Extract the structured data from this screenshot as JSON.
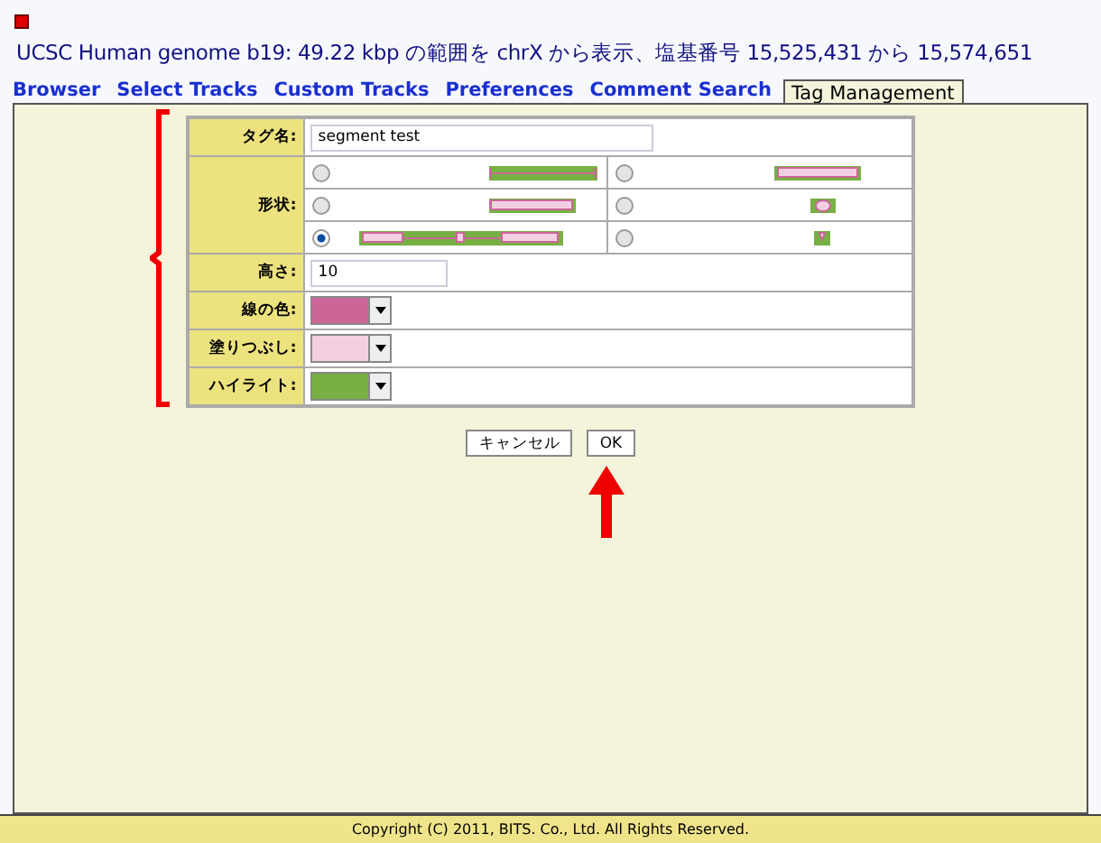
{
  "page": {
    "title": "UCSC Human genome b19: 49.22 kbp の範囲を chrX から表示、塩基番号 15,525,431 から 15,574,651"
  },
  "tabs": [
    {
      "label": "Browser",
      "selected": false
    },
    {
      "label": "Select Tracks",
      "selected": false
    },
    {
      "label": "Custom Tracks",
      "selected": false
    },
    {
      "label": "Preferences",
      "selected": false
    },
    {
      "label": "Comment Search",
      "selected": false
    },
    {
      "label": "Tag Management",
      "selected": true
    }
  ],
  "form": {
    "tag_name": {
      "label": "タグ名:",
      "value": "segment test"
    },
    "shape": {
      "label": "形状:",
      "options": [
        {
          "kind": "line",
          "selected": false
        },
        {
          "kind": "wide",
          "selected": false
        },
        {
          "kind": "box",
          "selected": false
        },
        {
          "kind": "dot",
          "selected": false
        },
        {
          "kind": "segments",
          "selected": true
        },
        {
          "kind": "pin",
          "selected": false
        }
      ]
    },
    "height": {
      "label": "高さ:",
      "value": "10"
    },
    "colors": [
      {
        "label": "線の色:",
        "color": "#cc6699"
      },
      {
        "label": "塗りつぶし:",
        "color": "#f2d0e2"
      },
      {
        "label": "ハイライト:",
        "color": "#77b043"
      }
    ]
  },
  "buttons": [
    "キャンセル",
    "OK"
  ],
  "footer": "Copyright (C) 2011, BITS. Co., Ltd. All Rights Reserved."
}
